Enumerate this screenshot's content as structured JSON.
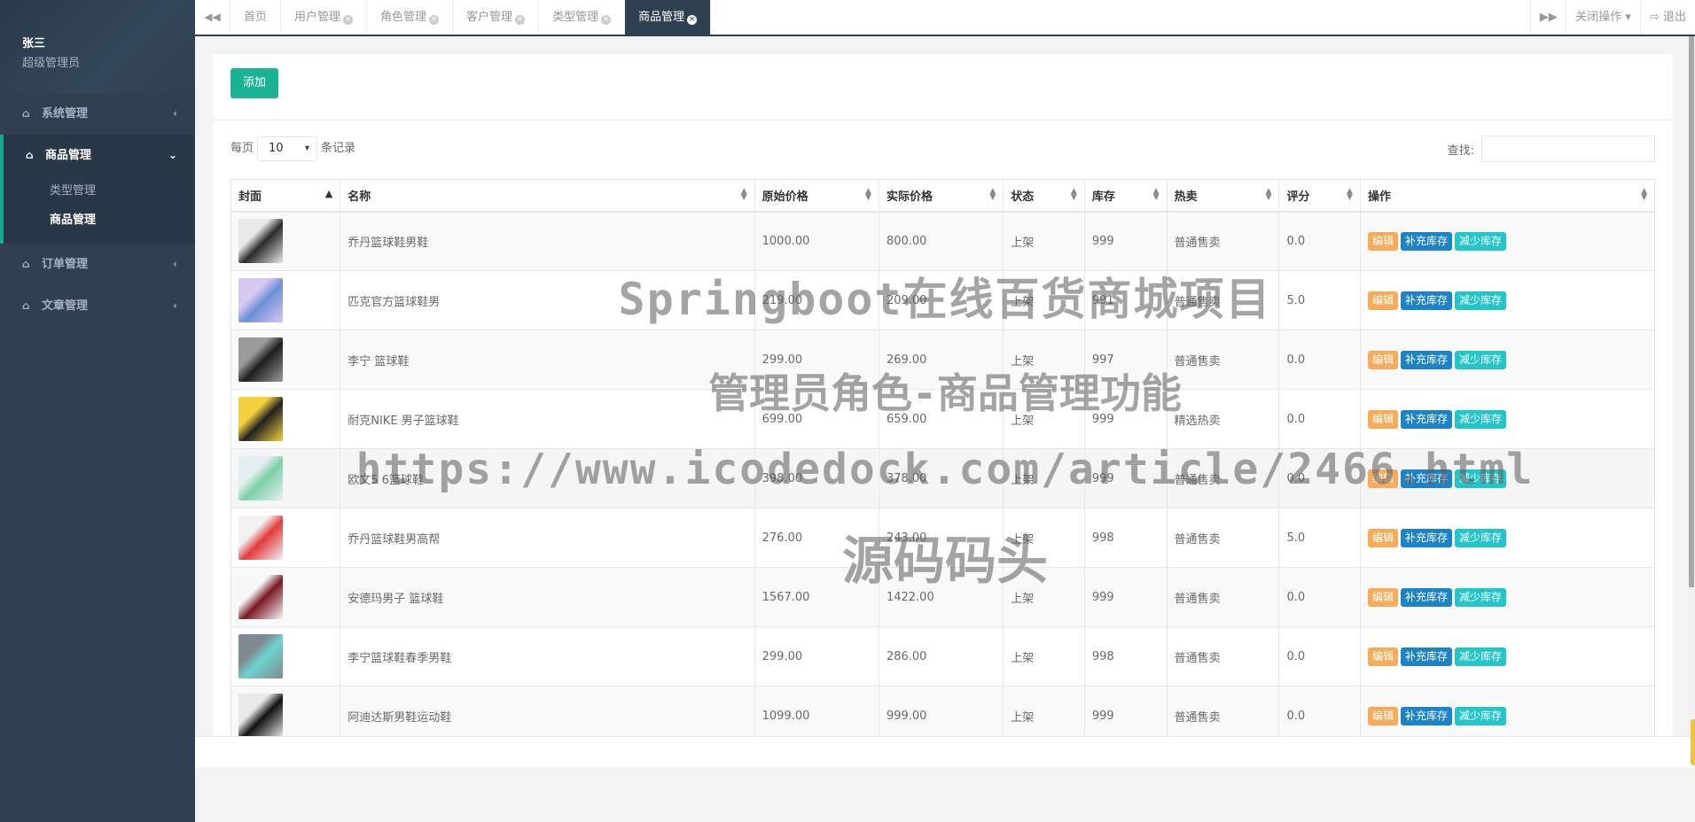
{
  "user": {
    "name": "张三",
    "role": "超级管理员"
  },
  "sidebar": {
    "groups": [
      {
        "label": "系统管理",
        "icon": "home-icon",
        "expanded": false
      },
      {
        "label": "商品管理",
        "icon": "home-icon",
        "expanded": true,
        "children": [
          {
            "label": "类型管理"
          },
          {
            "label": "商品管理",
            "active": true
          }
        ]
      },
      {
        "label": "订单管理",
        "icon": "home-icon",
        "expanded": false
      },
      {
        "label": "文章管理",
        "icon": "home-icon",
        "expanded": false
      }
    ]
  },
  "tabs": [
    {
      "label": "首页",
      "closable": false
    },
    {
      "label": "用户管理",
      "closable": true
    },
    {
      "label": "角色管理",
      "closable": true
    },
    {
      "label": "客户管理",
      "closable": true
    },
    {
      "label": "类型管理",
      "closable": true
    },
    {
      "label": "商品管理",
      "closable": true,
      "active": true
    }
  ],
  "topbar": {
    "close_ops": "关闭操作",
    "logout": "退出"
  },
  "toolbar": {
    "add_label": "添加"
  },
  "table_controls": {
    "per_page_prefix": "每页",
    "per_page_value": "10",
    "per_page_suffix": "条记录",
    "search_label": "查找:"
  },
  "table": {
    "columns": [
      "封面",
      "名称",
      "原始价格",
      "实际价格",
      "状态",
      "库存",
      "热卖",
      "评分",
      "操作"
    ],
    "actions": {
      "edit": "编辑",
      "add_stock": "补充库存",
      "reduce_stock": "减少库存"
    },
    "rows": [
      {
        "name": "乔丹篮球鞋男鞋",
        "orig_price": "1000.00",
        "price": "800.00",
        "status": "上架",
        "stock": "999",
        "hot": "普通售卖",
        "score": "0.0",
        "thumb": [
          "#2b2b2b",
          "#e8e8e8"
        ]
      },
      {
        "name": "匹克官方篮球鞋男",
        "orig_price": "219.00",
        "price": "209.00",
        "status": "上架",
        "stock": "991",
        "hot": "普通售卖",
        "score": "5.0",
        "thumb": [
          "#6b8fd6",
          "#d7c8f0"
        ]
      },
      {
        "name": "李宁 篮球鞋",
        "orig_price": "299.00",
        "price": "269.00",
        "status": "上架",
        "stock": "997",
        "hot": "普通售卖",
        "score": "0.0",
        "thumb": [
          "#1e1e1e",
          "#9a9a9a"
        ]
      },
      {
        "name": "耐克NIKE 男子篮球鞋",
        "orig_price": "699.00",
        "price": "659.00",
        "status": "上架",
        "stock": "999",
        "hot": "精选热卖",
        "score": "0.0",
        "thumb": [
          "#222",
          "#f3d03e"
        ]
      },
      {
        "name": "欧文5 6篮球鞋",
        "orig_price": "398.00",
        "price": "378.00",
        "status": "上架",
        "stock": "999",
        "hot": "普通售卖",
        "score": "0.0",
        "thumb": [
          "#7bd1a8",
          "#e5eef2"
        ]
      },
      {
        "name": "乔丹篮球鞋男高帮",
        "orig_price": "276.00",
        "price": "243.00",
        "status": "上架",
        "stock": "998",
        "hot": "普通售卖",
        "score": "5.0",
        "thumb": [
          "#e23b3b",
          "#f2f2f2"
        ]
      },
      {
        "name": "安德玛男子 篮球鞋",
        "orig_price": "1567.00",
        "price": "1422.00",
        "status": "上架",
        "stock": "999",
        "hot": "普通售卖",
        "score": "0.0",
        "thumb": [
          "#7a1a24",
          "#f7f7f7"
        ]
      },
      {
        "name": "李宁篮球鞋春季男鞋",
        "orig_price": "299.00",
        "price": "286.00",
        "status": "上架",
        "stock": "998",
        "hot": "普通售卖",
        "score": "0.0",
        "thumb": [
          "#6fd3cf",
          "#7e8a8f"
        ]
      },
      {
        "name": "阿迪达斯男鞋运动鞋",
        "orig_price": "1099.00",
        "price": "999.00",
        "status": "上架",
        "stock": "999",
        "hot": "普通售卖",
        "score": "0.0",
        "thumb": [
          "#111",
          "#e9e9e9"
        ]
      }
    ]
  },
  "watermark": {
    "line1": "Springboot在线百货商城项目",
    "line2": "管理员角色-商品管理功能",
    "line3": "https://www.icodedock.com/article/2466.html",
    "line4": "源码码头"
  }
}
